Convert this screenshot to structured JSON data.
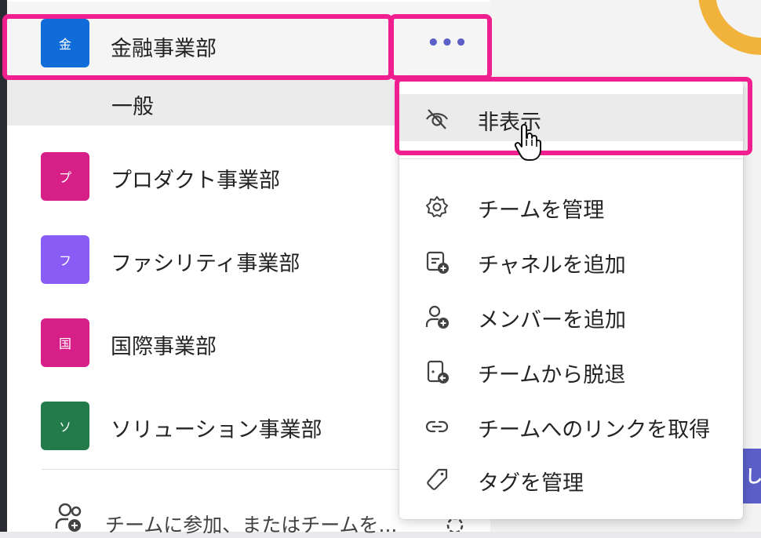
{
  "teams": [
    {
      "name": "金融事業部",
      "avatar": "金",
      "color": "#0f6cd8"
    },
    {
      "name": "プロダクト事業部",
      "avatar": "プ",
      "color": "#d61f87"
    },
    {
      "name": "ファシリティ事業部",
      "avatar": "フ",
      "color": "#8a5cf6"
    },
    {
      "name": "国際事業部",
      "avatar": "国",
      "color": "#d61f87"
    },
    {
      "name": "ソリューション事業部",
      "avatar": "ソ",
      "color": "#237b4b"
    }
  ],
  "channel": {
    "name": "一般"
  },
  "more_label": "•••",
  "join": {
    "label": "チームに参加、またはチームを..."
  },
  "menu": {
    "hide": "非表示",
    "items": [
      {
        "label": "チームを管理",
        "icon": "gear-icon"
      },
      {
        "label": "チャネルを追加",
        "icon": "add-channel-icon"
      },
      {
        "label": "メンバーを追加",
        "icon": "add-member-icon"
      },
      {
        "label": "チームから脱退",
        "icon": "leave-team-icon"
      },
      {
        "label": "チームへのリンクを取得",
        "icon": "link-icon"
      },
      {
        "label": "タグを管理",
        "icon": "tag-icon"
      }
    ]
  },
  "colors": {
    "highlight": "#ef1f90",
    "accent": "#5b5fc7"
  }
}
